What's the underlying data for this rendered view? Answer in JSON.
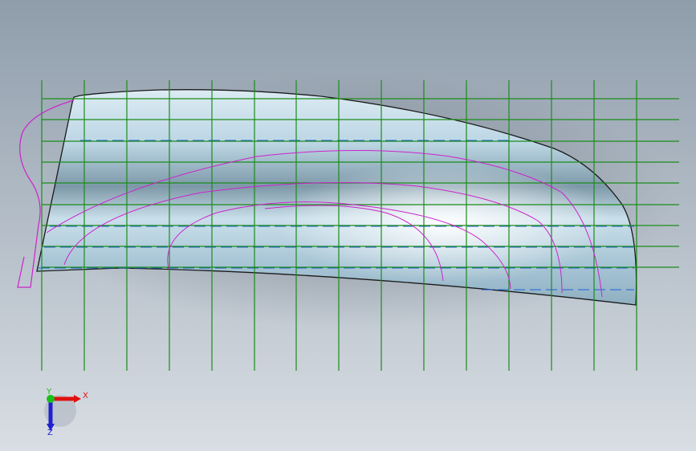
{
  "viewport": {
    "background_top": "#8f9dab",
    "background_bottom": "#d9dee4"
  },
  "surface": {
    "fill_light": "#f4f9fc",
    "fill_mid": "#b8d4e3",
    "fill_dark": "#6e8796",
    "edge_color": "#1a1a1a"
  },
  "sketch_grid": {
    "vertical_line_color": "#1a8c1a",
    "horizontal_line_color": "#1a8c1a",
    "vertical_line_count": 15,
    "horizontal_line_count": 9
  },
  "section_curves": {
    "color": "#cc22cc"
  },
  "isoparam_lines": {
    "color": "#1f5fd6"
  },
  "triad": {
    "x_label": "X",
    "y_label": "Y",
    "z_label": "Z",
    "x_color": "#e01010",
    "y_color": "#18c018",
    "z_color": "#2020d0"
  }
}
